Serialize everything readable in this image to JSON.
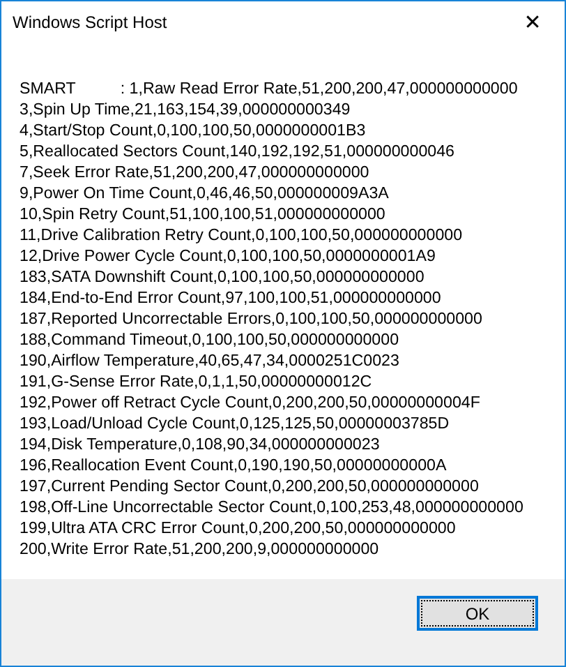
{
  "window": {
    "title": "Windows Script Host",
    "close_glyph": "✕"
  },
  "message_lines": [
    "SMART          : 1,Raw Read Error Rate,51,200,200,47,000000000000",
    "3,Spin Up Time,21,163,154,39,000000000349",
    "4,Start/Stop Count,0,100,100,50,0000000001B3",
    "5,Reallocated Sectors Count,140,192,192,51,000000000046",
    "7,Seek Error Rate,51,200,200,47,000000000000",
    "9,Power On Time Count,0,46,46,50,000000009A3A",
    "10,Spin Retry Count,51,100,100,51,000000000000",
    "11,Drive Calibration Retry Count,0,100,100,50,000000000000",
    "12,Drive Power Cycle Count,0,100,100,50,0000000001A9",
    "183,SATA Downshift Count,0,100,100,50,000000000000",
    "184,End-to-End Error Count,97,100,100,51,000000000000",
    "187,Reported Uncorrectable Errors,0,100,100,50,000000000000",
    "188,Command Timeout,0,100,100,50,000000000000",
    "190,Airflow Temperature,40,65,47,34,0000251C0023",
    "191,G-Sense Error Rate,0,1,1,50,00000000012C",
    "192,Power off Retract Cycle Count,0,200,200,50,00000000004F",
    "193,Load/Unload Cycle Count,0,125,125,50,00000003785D",
    "194,Disk Temperature,0,108,90,34,000000000023",
    "196,Reallocation Event Count,0,190,190,50,00000000000A",
    "197,Current Pending Sector Count,0,200,200,50,000000000000",
    "198,Off-Line Uncorrectable Sector Count,0,100,253,48,000000000000",
    "199,Ultra ATA CRC Error Count,0,200,200,50,000000000000",
    "200,Write Error Rate,51,200,200,9,000000000000"
  ],
  "buttons": [
    {
      "label": "OK"
    }
  ]
}
